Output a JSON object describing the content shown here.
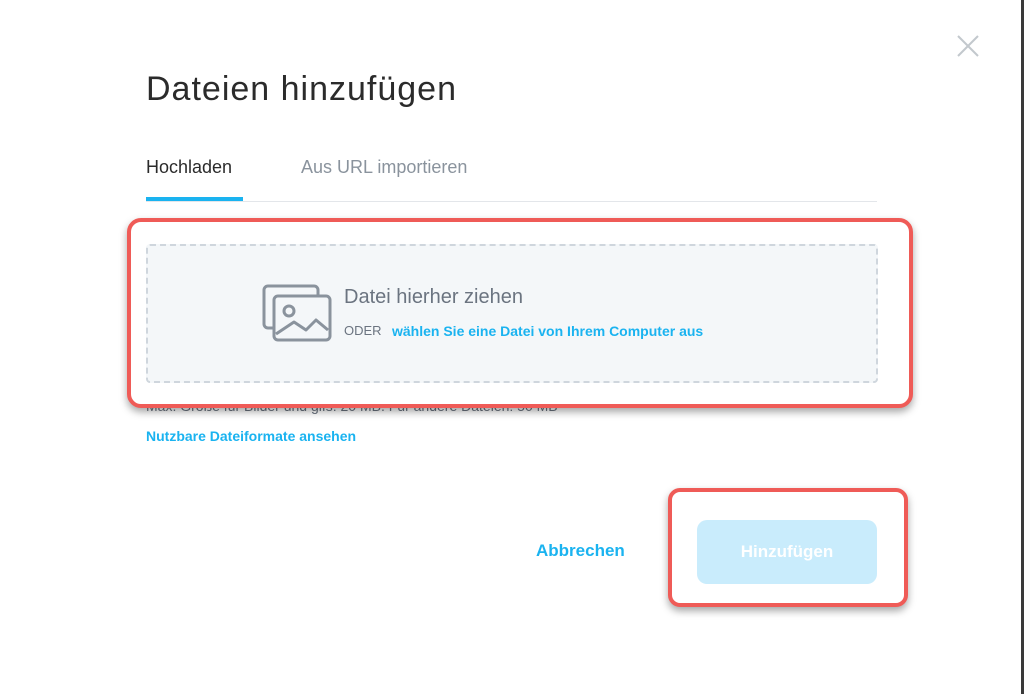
{
  "dialog": {
    "title": "Dateien hinzufügen",
    "close_icon": "close-icon"
  },
  "tabs": [
    {
      "label": "Hochladen",
      "active": true
    },
    {
      "label": "Aus URL importieren",
      "active": false
    }
  ],
  "dropzone": {
    "icon": "image-stack-icon",
    "title": "Datei hierher ziehen",
    "or_label": "ODER",
    "choose_link": "wählen Sie eine Datei von Ihrem Computer aus"
  },
  "info": {
    "size_limits": "Max. Größe für Bilder und gifs: 20 MB. Für andere Dateien: 50 MB",
    "formats_link": "Nutzbare Dateiformate ansehen"
  },
  "actions": {
    "cancel_label": "Abbrechen",
    "add_label": "Hinzufügen",
    "add_enabled": false
  },
  "colors": {
    "accent": "#1ab3f0",
    "highlight": "#ef5b57",
    "add_disabled_bg": "#c9ecfc",
    "text_dark": "#2b2b2b",
    "text_muted": "#8a939d"
  }
}
